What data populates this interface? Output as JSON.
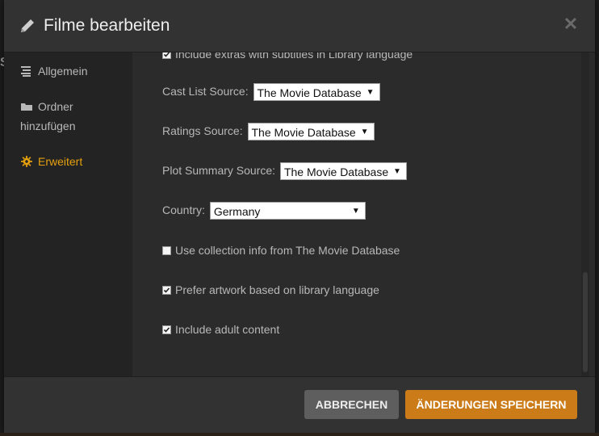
{
  "dialog": {
    "title": "Filme bearbeiten",
    "close_icon": "close-icon"
  },
  "sidebar": {
    "items": [
      {
        "label": "Allgemein",
        "icon": "list-icon",
        "active": false
      },
      {
        "label": "Ordner hinzufügen",
        "icon": "folder-icon",
        "active": false
      },
      {
        "label": "Erweitert",
        "icon": "gear-icon",
        "active": true
      }
    ]
  },
  "settings": {
    "partial_row": "Include extras with subtitles in Library language",
    "cast_list": {
      "label": "Cast List Source:",
      "value": "The Movie Database"
    },
    "ratings": {
      "label": "Ratings Source:",
      "value": "The Movie Database"
    },
    "plot_summary": {
      "label": "Plot Summary Source:",
      "value": "The Movie Database"
    },
    "country": {
      "label": "Country:",
      "value": "Germany"
    },
    "collection_info": {
      "label": "Use collection info from The Movie Database",
      "checked": false
    },
    "prefer_artwork": {
      "label": "Prefer artwork based on library language",
      "checked": true
    },
    "adult_content": {
      "label": "Include adult content",
      "checked": true
    }
  },
  "footer": {
    "cancel_label": "Abbrechen",
    "save_label": "Änderungen speichern"
  },
  "colors": {
    "accent": "#e5a00d",
    "save_button": "#cc7b19",
    "cancel_button": "#5e5e5e"
  }
}
